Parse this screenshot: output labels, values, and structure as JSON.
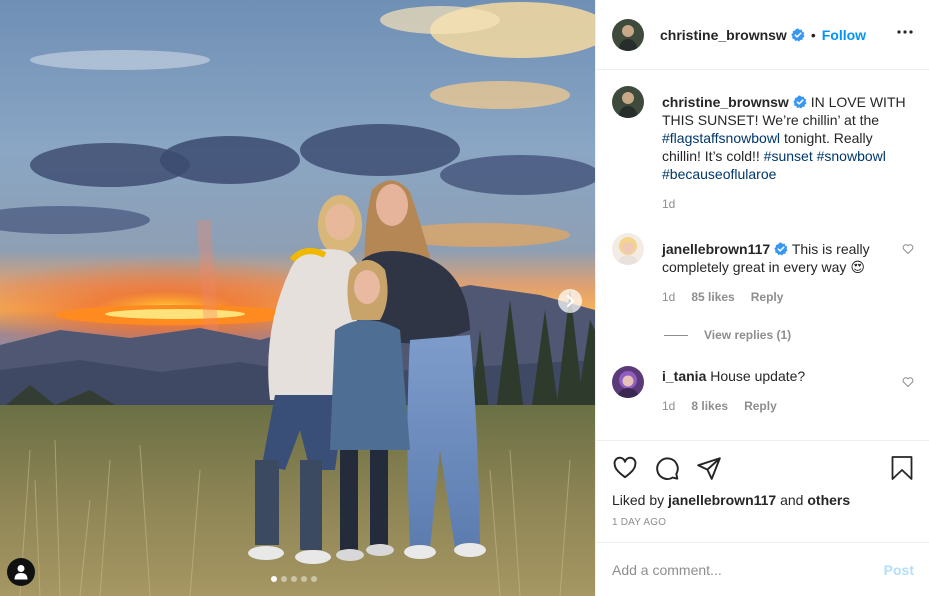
{
  "header": {
    "username": "christine_brownsw",
    "separator": "•",
    "follow_label": "Follow"
  },
  "caption": {
    "username": "christine_brownsw",
    "text_1": "IN LOVE WITH THIS SUNSET! We’re chillin’ at the",
    "hashtag_1": "#flagstaffsnowbowl",
    "text_2": "tonight. Really chillin! It’s cold!!",
    "hashtag_2": "#sunset",
    "hashtag_3": "#snowbowl",
    "hashtag_4": "#becauseoflularoe",
    "time": "1d"
  },
  "comments": [
    {
      "username": "janellebrown117",
      "verified": true,
      "text": "This is really completely great in every way",
      "emoji": "😍",
      "time": "1d",
      "likes": "85 likes",
      "reply_label": "Reply",
      "view_replies": "View replies (1)"
    },
    {
      "username": "i_tania",
      "verified": false,
      "text": "House update?",
      "time": "1d",
      "likes": "8 likes",
      "reply_label": "Reply"
    }
  ],
  "likes": {
    "prefix": "Liked by",
    "user": "janellebrown117",
    "connector": "and",
    "others": "others"
  },
  "post_time": "1 DAY AGO",
  "add_comment": {
    "placeholder": "Add a comment...",
    "post_label": "Post"
  },
  "carousel": {
    "total": 5,
    "active_index": 1
  },
  "colors": {
    "accent": "#0095f6",
    "hashtag": "#00376b",
    "muted": "#8e8e8e",
    "post_disabled": "#b2dffc"
  },
  "icons": [
    "verified-badge-icon",
    "more-options-icon",
    "heart-icon",
    "comment-icon",
    "share-icon",
    "bookmark-icon",
    "chevron-right-icon",
    "user-tag-icon"
  ]
}
